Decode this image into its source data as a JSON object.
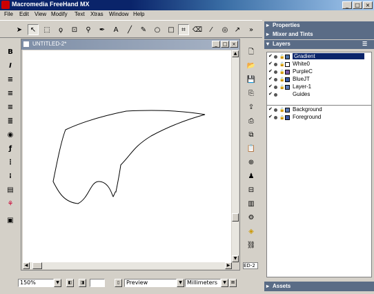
{
  "window": {
    "title": "Macromedia FreeHand MX",
    "min": "_",
    "max": "□",
    "close": "×"
  },
  "menu": [
    "File",
    "Edit",
    "View",
    "Modify",
    "Text",
    "Xtras",
    "Window",
    "Help"
  ],
  "doc": {
    "title": "UNTITLED-2*",
    "tab_label": "ED-2"
  },
  "panels": {
    "properties": "Properties",
    "mixer": "Mixer and Tints",
    "layers": "Layers",
    "assets": "Assets"
  },
  "layers_top": [
    {
      "name": "Gradient",
      "color": "#4a6fa5",
      "selected": true
    },
    {
      "name": "White0",
      "color": "#ffffff"
    },
    {
      "name": "PurpleC",
      "color": "#7a5aa5"
    },
    {
      "name": "BlueJT",
      "color": "#3a5aa5"
    },
    {
      "name": "Layer-1",
      "color": "#5a7ab5"
    },
    {
      "name": "Guides",
      "color": "#d4d0c8"
    }
  ],
  "layers_bottom": [
    {
      "name": "Background",
      "color": "#5a7ab5"
    },
    {
      "name": "Foreground",
      "color": "#3a5aa5"
    }
  ],
  "status": {
    "zoom": "150%",
    "view_mode": "Preview",
    "units": "Millimeters"
  }
}
